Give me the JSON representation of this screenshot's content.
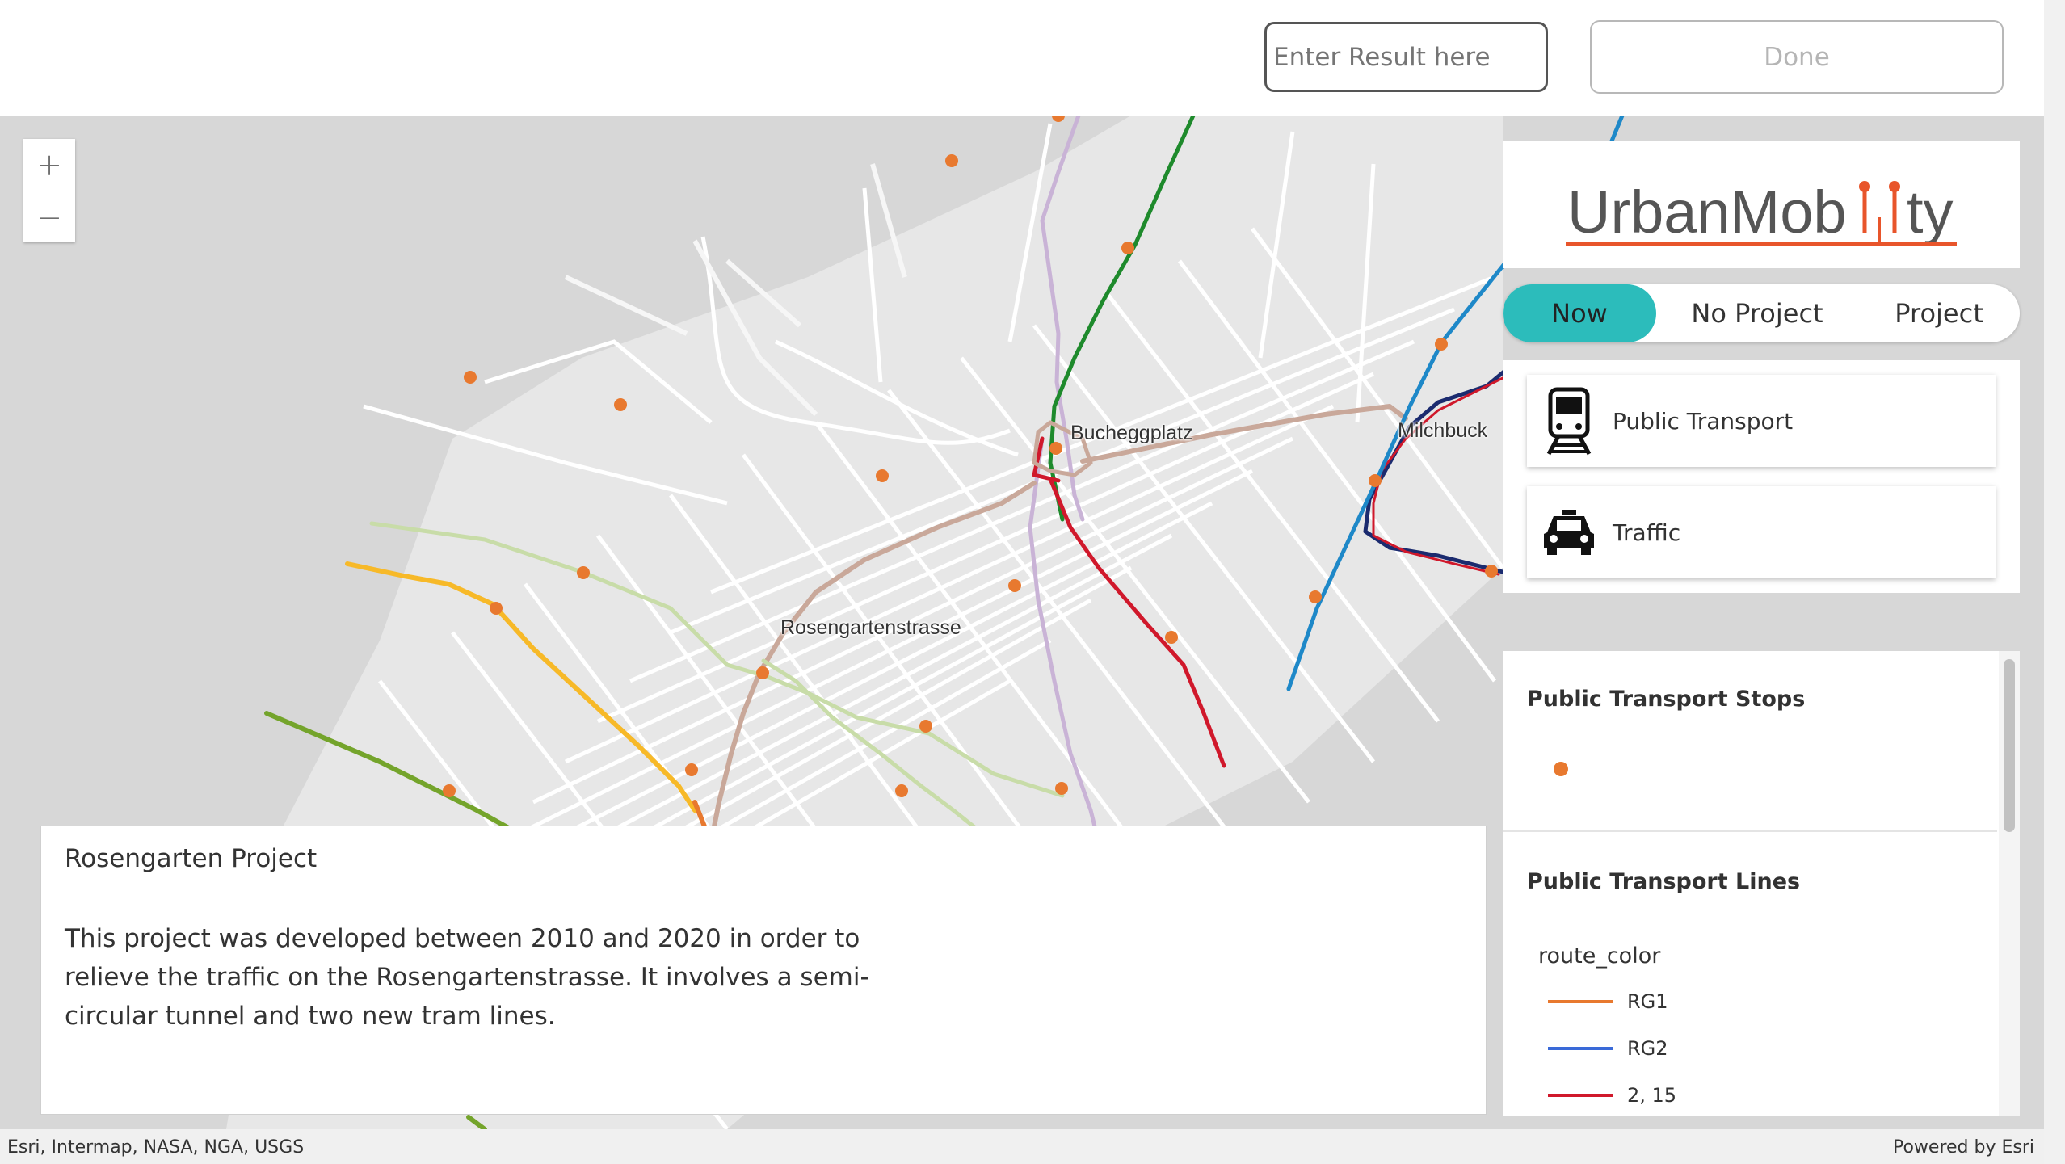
{
  "topbar": {
    "result_placeholder": "Enter Result here",
    "done_label": "Done"
  },
  "map": {
    "zoom_in": "+",
    "zoom_out": "−",
    "labels": {
      "bucheggplatz": "Bucheggplatz",
      "milchbuck": "Milchbuck",
      "rosengartenstrasse": "Rosengartenstrasse"
    },
    "colors": {
      "background": "#d7d7d7",
      "streets": "#ffffff",
      "stop": "#e8792f"
    }
  },
  "logo": {
    "text_before": "UrbanMob",
    "text_after": "ty",
    "accent": "#e8552b"
  },
  "mode_toggle": {
    "options": [
      "Now",
      "No Project",
      "Project"
    ],
    "active": "Now",
    "active_color": "#2cbcbb"
  },
  "layers": [
    {
      "label": "Public Transport",
      "icon": "train-icon"
    },
    {
      "label": "Traffic",
      "icon": "car-icon"
    }
  ],
  "legend": {
    "stops_title": "Public Transport Stops",
    "lines_title": "Public Transport Lines",
    "field": "route_color",
    "items": [
      {
        "label": "RG1",
        "color": "#e8792f"
      },
      {
        "label": "RG2",
        "color": "#3a6ad8"
      },
      {
        "label": "2, 15",
        "color": "#d0182b"
      }
    ]
  },
  "info": {
    "title": "Rosengarten Project",
    "body": "This project was developed between 2010 and 2020 in order to relieve the traffic on the Rosengartenstrasse. It involves a semi-circular tunnel and two new tram lines."
  },
  "attribution": {
    "left": "Esri, Intermap, NASA, NGA, USGS",
    "right": "Powered by Esri"
  }
}
